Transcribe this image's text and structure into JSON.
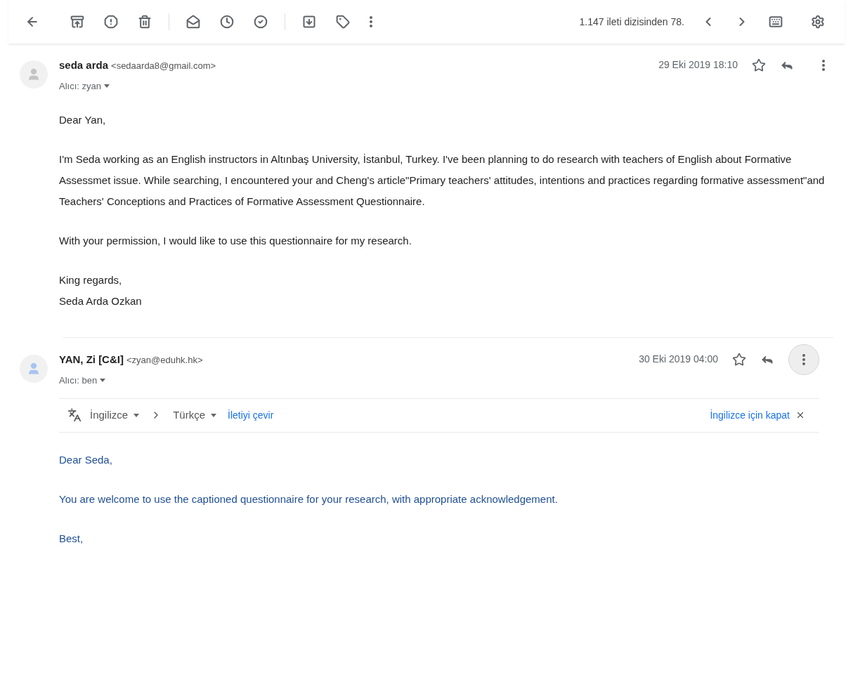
{
  "toolbar": {
    "page_info": "1.147 ileti dizisinden 78."
  },
  "messages": [
    {
      "sender_name": "seda arda",
      "sender_email": "<sedaarda8@gmail.com>",
      "recipient": "Alıcı: zyan",
      "date": "29 Eki 2019 18:10",
      "color": "#c4c4c4",
      "more_highlighted": false,
      "translated": false,
      "paragraphs": [
        "Dear Yan,",
        "I'm Seda working as an English instructors in Altınbaş University, İstanbul, Turkey. I've been planning to do research with teachers of English about Formative Assessmet issue. While searching, I encountered your and Cheng's article\"Primary teachers' attitudes, intentions and practices regarding formative assessment\"and Teachers' Conceptions and Practices of Formative Assessment Questionnaire.",
        "With your permission, I would like to use this questionnaire for my research.",
        "King regards,\nSeda Arda Ozkan"
      ]
    },
    {
      "sender_name": "YAN, Zi [C&I]",
      "sender_email": "<zyan@eduhk.hk>",
      "recipient": "Alıcı: ben",
      "date": "30 Eki 2019 04:00",
      "color": "#a8c4f0",
      "more_highlighted": true,
      "translated": true,
      "translation": {
        "from": "İngilizce",
        "to": "Türkçe",
        "translate_link": "İletiyi çevir",
        "close_link": "İngilizce için kapat"
      },
      "paragraphs": [
        "Dear Seda,",
        "You are welcome to use the captioned questionnaire for your research, with appropriate acknowledgement.",
        "Best,"
      ]
    }
  ]
}
